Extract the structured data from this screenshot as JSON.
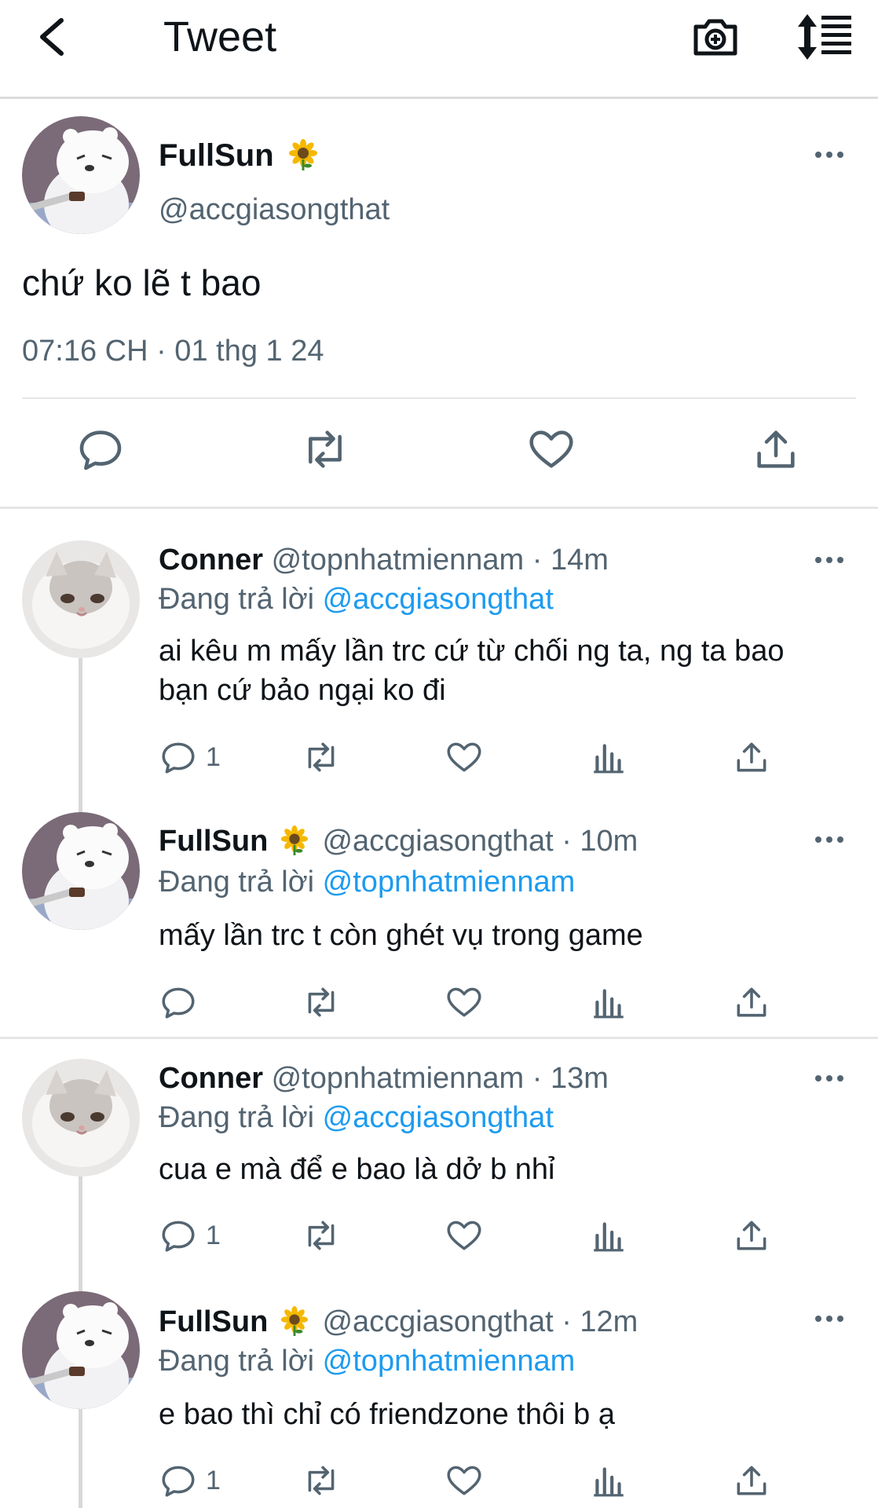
{
  "header": {
    "title": "Tweet",
    "icons": [
      "back-arrow-icon",
      "camera-plus-icon",
      "sort-icon"
    ]
  },
  "main_tweet": {
    "name": "FullSun",
    "emoji": "sunflower",
    "handle": "@accgiasongthat",
    "text": "chứ ko lẽ t bao",
    "time": "07:16 CH · 01 thg 1 24"
  },
  "replies": [
    {
      "name": "Conner",
      "handle_time": "@topnhatmiennam · 14m",
      "reply_label": "Đang trả lời",
      "mention": "@accgiasongthat",
      "text": "ai kêu m mấy lần trc cứ từ chối ng ta, ng ta bao bạn cứ bảo ngại ko đi",
      "reply_count": "1"
    },
    {
      "name": "FullSun",
      "handle_time": "@accgiasongthat · 10m",
      "reply_label": "Đang trả lời",
      "mention": "@topnhatmiennam",
      "text": "mấy lần trc t còn ghét vụ trong game",
      "reply_count": ""
    },
    {
      "name": "Conner",
      "handle_time": "@topnhatmiennam · 13m",
      "reply_label": "Đang trả lời",
      "mention": "@accgiasongthat",
      "text": "cua e mà để e bao là dở b nhỉ",
      "reply_count": "1"
    },
    {
      "name": "FullSun",
      "handle_time": "@accgiasongthat · 12m",
      "reply_label": "Đang trả lời",
      "mention": "@topnhatmiennam",
      "text": "e bao thì chỉ có friendzone thôi b ạ",
      "reply_count": "1"
    }
  ],
  "colors": {
    "link": "#1d9bf0",
    "secondary": "#536471",
    "text": "#0f1419",
    "divider": "#e6e6e6"
  }
}
